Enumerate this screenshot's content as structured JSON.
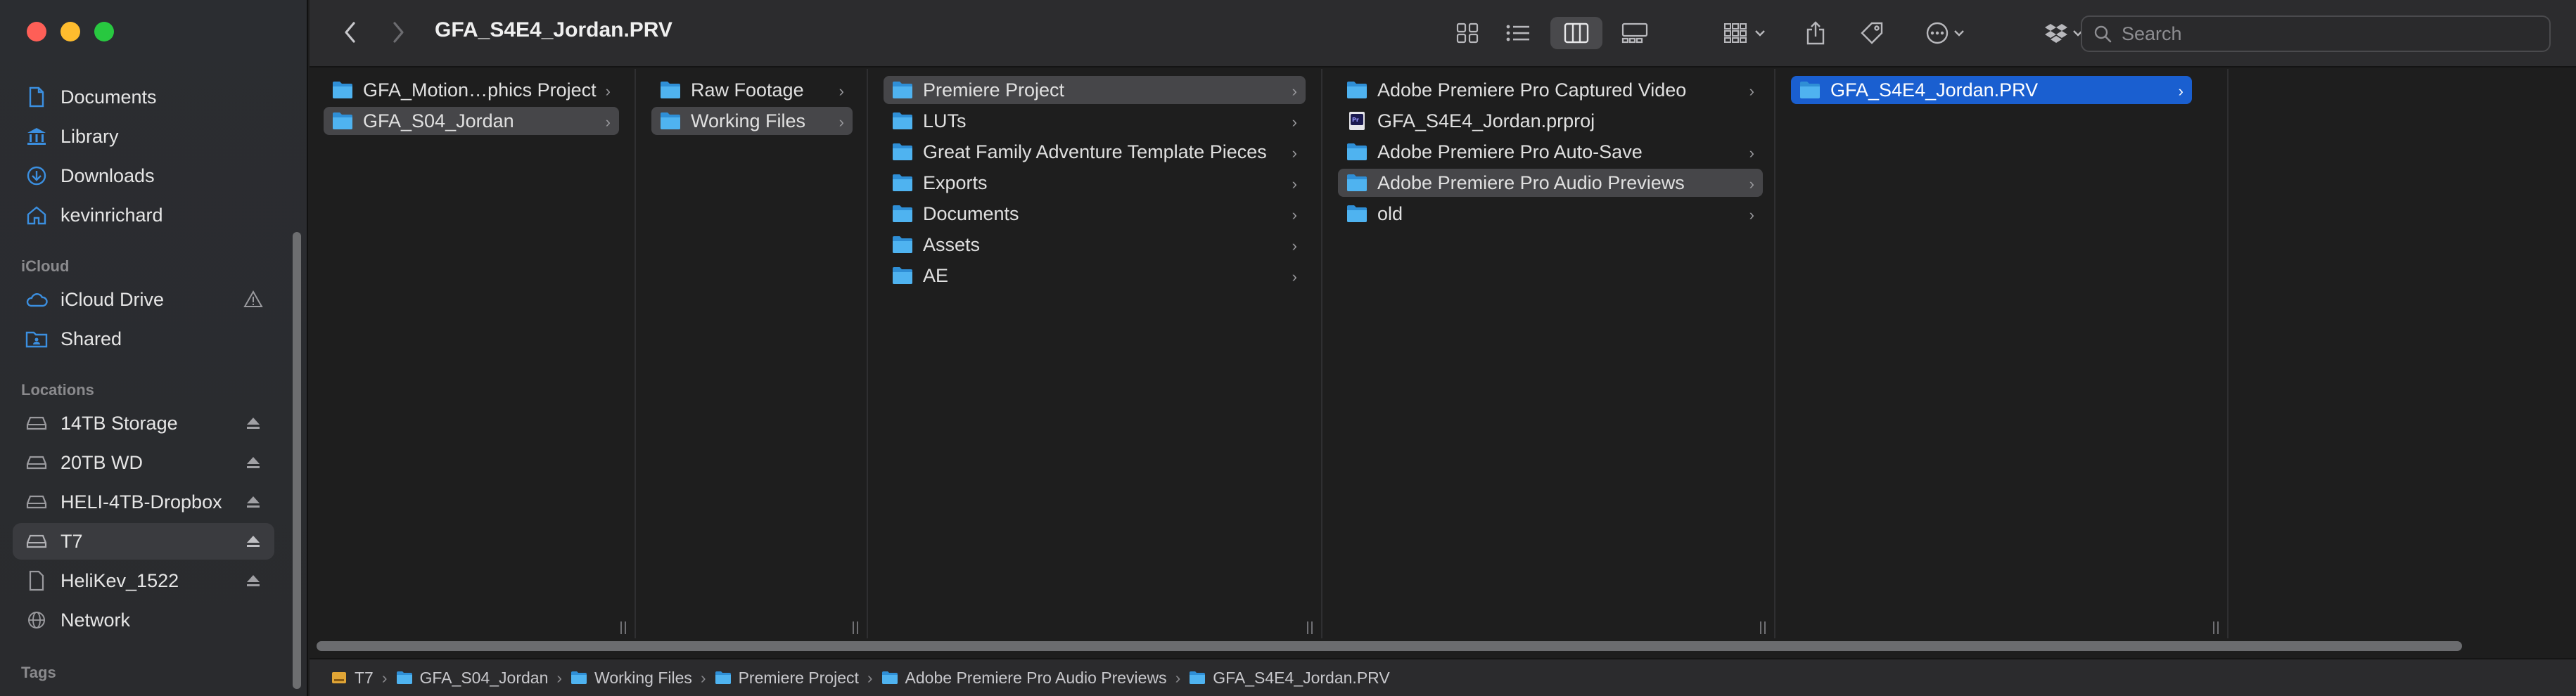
{
  "window": {
    "title": "GFA_S4E4_Jordan.PRV"
  },
  "toolbar": {
    "search_placeholder": "Search"
  },
  "sidebar": {
    "favorites": [
      {
        "label": "Documents",
        "icon": "document-icon"
      },
      {
        "label": "Library",
        "icon": "library-icon"
      },
      {
        "label": "Downloads",
        "icon": "downloads-icon"
      },
      {
        "label": "kevinrichard",
        "icon": "home-icon"
      }
    ],
    "icloud_header": "iCloud",
    "icloud": [
      {
        "label": "iCloud Drive",
        "icon": "cloud-icon"
      },
      {
        "label": "Shared",
        "icon": "shared-folder-icon"
      }
    ],
    "locations_header": "Locations",
    "locations": [
      {
        "label": "14TB Storage",
        "icon": "drive-icon"
      },
      {
        "label": "20TB WD",
        "icon": "drive-icon"
      },
      {
        "label": "HELI-4TB-Dropbox",
        "icon": "drive-icon"
      },
      {
        "label": "T7",
        "icon": "drive-icon",
        "selected": true
      },
      {
        "label": "HeliKev_1522",
        "icon": "file-icon"
      },
      {
        "label": "Network",
        "icon": "globe-icon"
      }
    ],
    "tags_header": "Tags"
  },
  "columns": [
    {
      "items": [
        "GFA_Motion…phics Project",
        "GFA_S04_Jordan"
      ]
    },
    {
      "items": [
        "Raw Footage",
        "Working Files"
      ]
    },
    {
      "items": [
        "Premiere Project",
        "LUTs",
        "Great Family Adventure Template Pieces",
        "Exports",
        "Documents",
        "Assets",
        "AE"
      ]
    },
    {
      "items": [
        "Adobe Premiere Pro Captured Video",
        "GFA_S4E4_Jordan.prproj",
        "Adobe Premiere Pro Auto-Save",
        "Adobe Premiere Pro Audio Previews",
        "old"
      ]
    },
    {
      "items": [
        "GFA_S4E4_Jordan.PRV"
      ]
    }
  ],
  "pathbar": {
    "segments": [
      "T7",
      "GFA_S04_Jordan",
      "Working Files",
      "Premiere Project",
      "Adobe Premiere Pro Audio Previews",
      "GFA_S4E4_Jordan.PRV"
    ]
  },
  "colors": {
    "selection_blue": "#1a5fd0",
    "selection_gray": "#464649",
    "folder_blue": "#38a6e6"
  }
}
